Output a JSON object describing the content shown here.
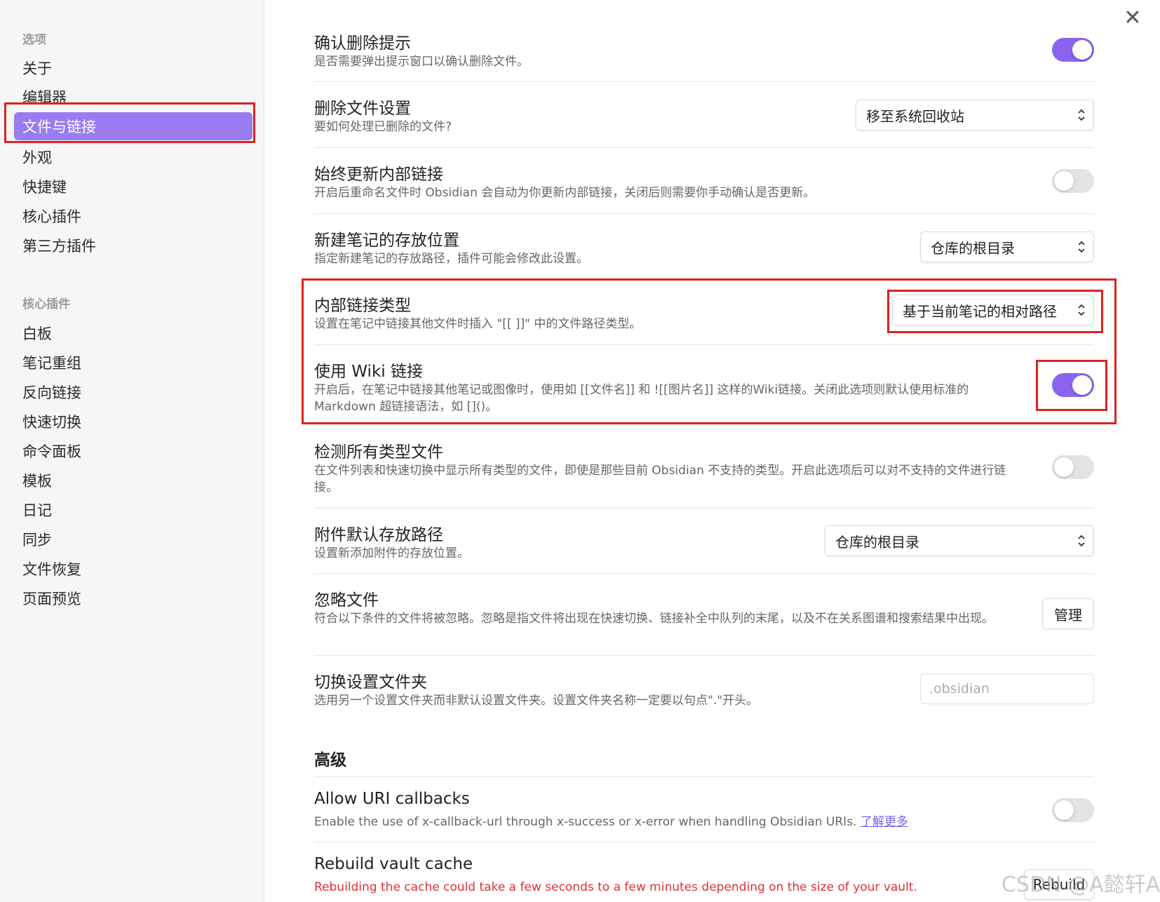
{
  "sidebar": {
    "options_header": "选项",
    "options_items": [
      "关于",
      "编辑器",
      "文件与链接",
      "外观",
      "快捷键",
      "核心插件",
      "第三方插件"
    ],
    "core_header": "核心插件",
    "core_items": [
      "白板",
      "笔记重组",
      "反向链接",
      "快速切换",
      "命令面板",
      "模板",
      "日记",
      "同步",
      "文件恢复",
      "页面预览"
    ]
  },
  "close_label": "✕",
  "settings": {
    "confirm_delete": {
      "name": "确认删除提示",
      "desc": "是否需要弹出提示窗口以确认删除文件。",
      "on": true
    },
    "delete_files": {
      "name": "删除文件设置",
      "desc": "要如何处理已删除的文件?",
      "value": "移至系统回收站"
    },
    "update_links": {
      "name": "始终更新内部链接",
      "desc": "开启后重命名文件时 Obsidian 会自动为你更新内部链接，关闭后则需要你手动确认是否更新。",
      "on": false
    },
    "new_note_location": {
      "name": "新建笔记的存放位置",
      "desc": "指定新建笔记的存放路径，插件可能会修改此设置。",
      "value": "仓库的根目录"
    },
    "link_format": {
      "name": "内部链接类型",
      "desc": "设置在笔记中链接其他文件时插入 \"[[ ]]\" 中的文件路径类型。",
      "value": "基于当前笔记的相对路径"
    },
    "wiki_links": {
      "name": "使用 Wiki 链接",
      "desc": "开启后，在笔记中链接其他笔记或图像时，使用如 [[文件名]] 和 ![[图片名]] 这样的Wiki链接。关闭此选项则默认使用标准的 Markdown 超链接语法，如 []()。",
      "on": true
    },
    "detect_all": {
      "name": "检测所有类型文件",
      "desc": "在文件列表和快速切换中显示所有类型的文件，即使是那些目前 Obsidian 不支持的类型。开启此选项后可以对不支持的文件进行链接。",
      "on": false
    },
    "attachment_path": {
      "name": "附件默认存放路径",
      "desc": "设置新添加附件的存放位置。",
      "value": "仓库的根目录"
    },
    "excluded_files": {
      "name": "忽略文件",
      "desc": "符合以下条件的文件将被忽略。忽略是指文件将出现在快速切换、链接补全中队列的末尾，以及不在关系图谱和搜索结果中出现。",
      "button": "管理"
    },
    "config_folder": {
      "name": "切换设置文件夹",
      "desc": "选用另一个设置文件夹而非默认设置文件夹。设置文件夹名称一定要以句点\".\"开头。",
      "placeholder": ".obsidian"
    },
    "advanced_heading": "高级",
    "uri_callbacks": {
      "name": "Allow URI callbacks",
      "desc": "Enable the use of x-callback-url through x-success or x-error when handling Obsidian URIs.",
      "link": "了解更多",
      "on": false
    },
    "rebuild_cache": {
      "name": "Rebuild vault cache",
      "desc": "Rebuilding the cache could take a few seconds to a few minutes depending on the size of your vault.",
      "button": "Rebuild"
    }
  },
  "watermark": "CSDN @A懿轩A",
  "colors": {
    "accent": "#8a63f0",
    "highlight_box": "#e02020"
  }
}
